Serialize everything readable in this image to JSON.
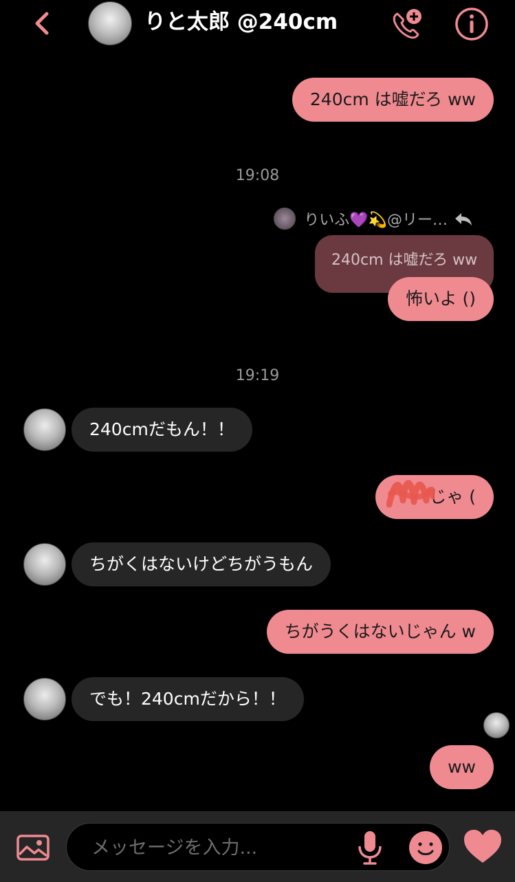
{
  "header": {
    "title": "りと太郎 @240cm",
    "back_icon": "chevron-left-icon",
    "call_icon": "phone-plus-icon",
    "info_icon": "info-icon"
  },
  "colors": {
    "accent": "#F08A91",
    "quoted_bg": "#6A3A40",
    "incoming_bg": "#262626",
    "background": "#000000"
  },
  "messages": {
    "m1": "240cm は嘘だろ ww",
    "ts1": "19:08",
    "reply_sender": "りいふ💜💫@リー…",
    "quoted_text": "240cm は嘘だろ ww",
    "m2": "怖いよ ()",
    "ts2": "19:19",
    "m3": "240cmだもん！！",
    "m4": "じゃ (",
    "m5": "ちがくはないけどちがうもん",
    "m6": "ちがうくはないじゃん w",
    "m7": "でも！240cmだから！！",
    "m8": "ww"
  },
  "composer": {
    "placeholder": "メッセージを入力...",
    "gallery_icon": "image-icon",
    "mic_icon": "microphone-icon",
    "sticker_icon": "smile-icon",
    "heart_icon": "heart-icon"
  }
}
